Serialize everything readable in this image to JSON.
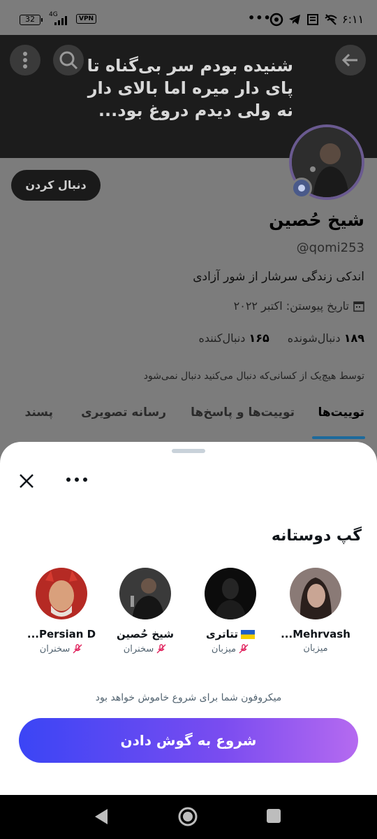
{
  "status_bar": {
    "battery": "32",
    "network": "4G",
    "vpn": "VPN",
    "more_dots": "•••",
    "time": "۶:۱۱"
  },
  "profile": {
    "banner_text": "شنیده بودم سر بی‌گناه تا پای دار میره اما بالای دار نه ولی دیدم دروغ بود...",
    "follow_label": "دنبال کردن",
    "name": "شیخ حُصین",
    "handle": "@qomi253",
    "bio": "اندکی زندگی سرشار از شور آزادی",
    "joined": "تاریخ پیوستن: اکتبر ۲۰۲۲",
    "following_count": "۱۸۹",
    "following_label": "دنبال‌شونده",
    "followers_count": "۱۶۵",
    "followers_label": "دنبال‌کننده",
    "no_mutual": "توسط هیچ‌یک از کسانی‌که دنبال می‌کنید دنبال نمی‌شود",
    "tabs": [
      {
        "label": "توییت‌ها",
        "active": true
      },
      {
        "label": "توییت‌ها و پاسخ‌ها",
        "active": false
      },
      {
        "label": "رسانه تصویری",
        "active": false
      },
      {
        "label": "پسند",
        "active": false
      }
    ]
  },
  "sheet": {
    "title": "گپ دوستانه",
    "participants": [
      {
        "name": "Mehrvash...",
        "role": "میزبان",
        "muted": false,
        "avatar_color": "#6b5a55"
      },
      {
        "name": "تتاتری",
        "flag": "ukraine",
        "role": "میزبان",
        "muted": true,
        "avatar_color": "#1a1a1a"
      },
      {
        "name": "شیخ حُصین",
        "role": "سخنران",
        "muted": true,
        "avatar_color": "#2a2a2a"
      },
      {
        "name": "Persian D...",
        "role": "سخنران",
        "muted": true,
        "avatar_color": "#c0302a"
      }
    ],
    "mic_note": "میکروفون شما برای شروع خاموش خواهد بود",
    "listen_label": "شروع به گوش دادن"
  },
  "colors": {
    "accent_gradient_start": "#3b45f5",
    "accent_gradient_end": "#b56af0",
    "mic_muted": "#e0245e",
    "tab_underline": "#1d6a9c"
  },
  "icons": [
    "battery-icon",
    "signal-icon",
    "camera-app-icon",
    "telegram-icon",
    "news-icon",
    "wifi-off-icon",
    "back-arrow-icon",
    "search-icon",
    "kebab-menu-icon",
    "calendar-icon",
    "close-icon",
    "more-horizontal-icon",
    "mic-off-icon",
    "ukraine-flag-icon",
    "nav-back-icon",
    "nav-home-icon",
    "nav-recents-icon"
  ]
}
